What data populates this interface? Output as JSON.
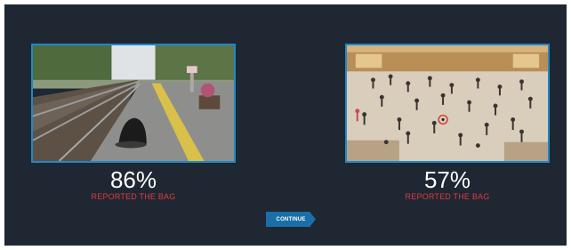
{
  "left_card": {
    "image": "train-station-platform-abandoned-bag",
    "percentage": "86%",
    "caption": "REPORTED THE BAG"
  },
  "right_card": {
    "image": "crowded-concourse-hall-with-circled-bag",
    "percentage": "57%",
    "caption": "REPORTED THE BAG"
  },
  "continue_button": {
    "label": "CONTINUE"
  },
  "colors": {
    "background": "#1f2733",
    "card_border": "#1e89c9",
    "caption": "#e0393f",
    "button": "#1a6fa8"
  }
}
